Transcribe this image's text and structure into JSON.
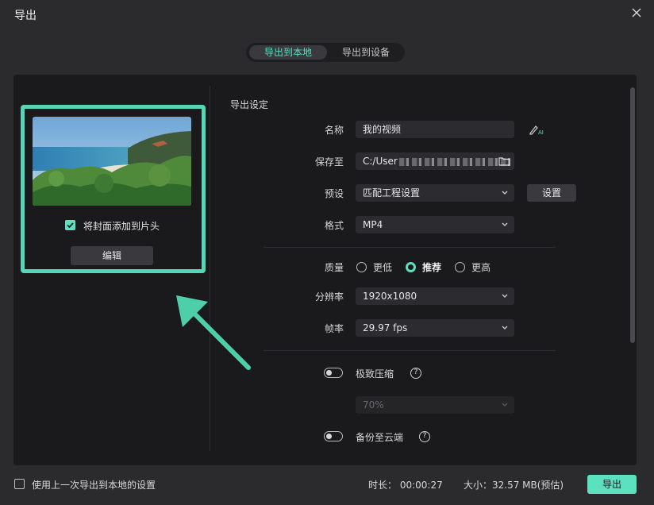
{
  "window": {
    "title": "导出"
  },
  "tabs": {
    "local": "导出到本地",
    "device": "导出到设备"
  },
  "preview": {
    "cover_checkbox_label": "将封面添加到片头",
    "cover_checked": true,
    "edit_button": "编辑"
  },
  "settings": {
    "section_title": "导出设定",
    "name_label": "名称",
    "name_value": "我的视频",
    "save_label": "保存至",
    "save_path": "C:/User",
    "preset_label": "预设",
    "preset_value": "匹配工程设置",
    "preset_button": "设置",
    "format_label": "格式",
    "format_value": "MP4",
    "quality_label": "质量",
    "quality_options": [
      "更低",
      "推荐",
      "更高"
    ],
    "quality_selected": "推荐",
    "resolution_label": "分辨率",
    "resolution_value": "1920x1080",
    "framerate_label": "帧率",
    "framerate_value": "29.97 fps",
    "compress_label": "极致压缩",
    "compress_value": "70%",
    "backup_label": "备份至云端",
    "help_glyph": "?"
  },
  "footer": {
    "remember_label": "使用上一次导出到本地的设置",
    "duration_text": "时长：  00:00:27",
    "size_text": "大小：32.57 MB(预估)",
    "export_button": "导出"
  },
  "colors": {
    "accent": "#5be0c0",
    "highlight_border": "#55d6b4",
    "background": "#2b2b2e",
    "panel": "#1a1a1c"
  }
}
